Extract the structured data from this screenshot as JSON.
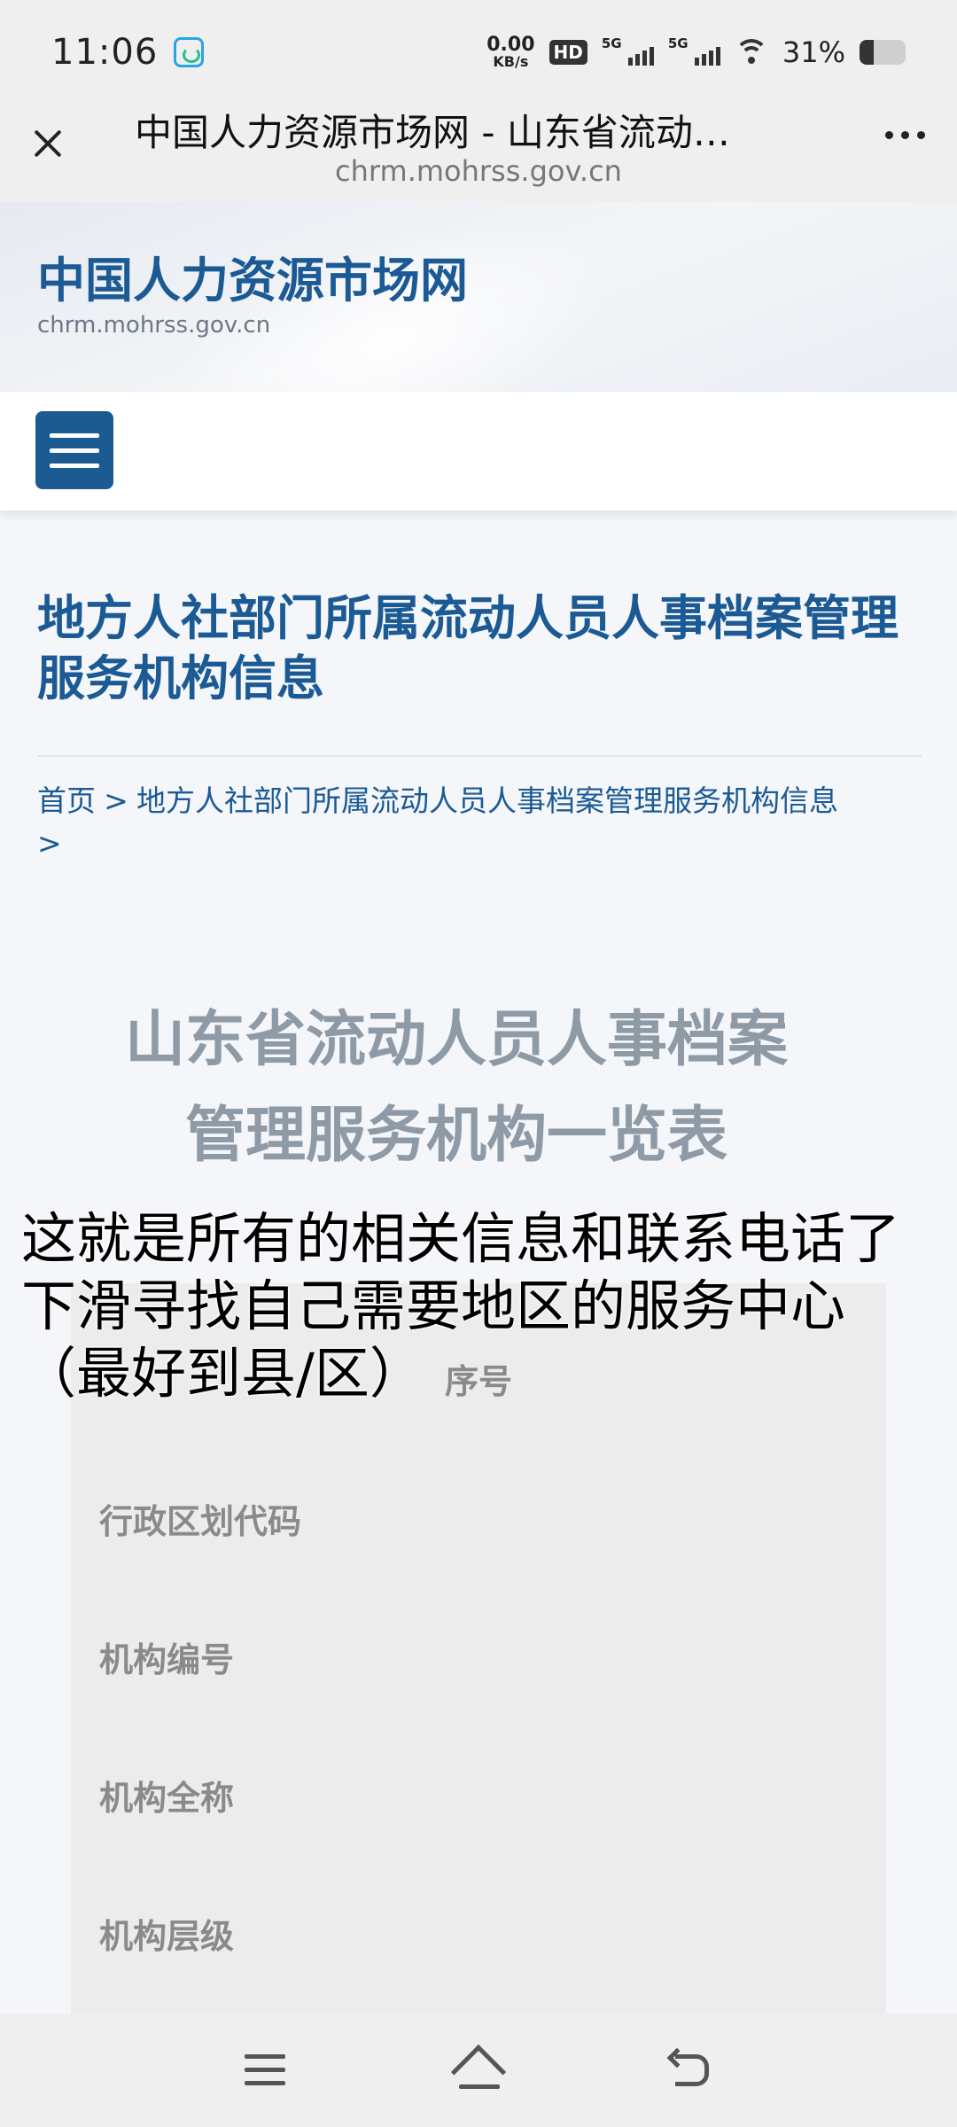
{
  "status_bar": {
    "time": "11:06",
    "net_speed_value": "0.00",
    "net_speed_unit": "KB/s",
    "hd_label": "HD",
    "sim1_label": "5G",
    "sim2_label": "5G",
    "battery_percent": "31%",
    "battery_level": 0.31
  },
  "browser": {
    "title": "中国人力资源市场网 - 山东省流动…",
    "url": "chrm.mohrss.gov.cn"
  },
  "site_header": {
    "title": "中国人力资源市场网",
    "subtitle": "chrm.mohrss.gov.cn"
  },
  "page": {
    "heading": "地方人社部门所属流动人员人事档案管理服务机构信息",
    "breadcrumb": {
      "home": "首页",
      "separator": ">",
      "current": "地方人社部门所属流动人员人事档案管理服务机构信息"
    },
    "article_title_line1": "山东省流动人员人事档案",
    "article_title_line2": "管理服务机构一览表"
  },
  "table": {
    "column_header": "序号",
    "fields": [
      "行政区划代码",
      "机构编号",
      "机构全称",
      "机构层级"
    ]
  },
  "overlay_caption": {
    "line1": "这就是所有的相关信息和联系电话了",
    "line2": "下滑寻找自己需要地区的服务中心",
    "line3": "（最好到县/区）"
  },
  "colors": {
    "brand_blue": "#1b5a94",
    "menu_button": "#1c5a92",
    "muted_title": "#8e9aa6"
  }
}
